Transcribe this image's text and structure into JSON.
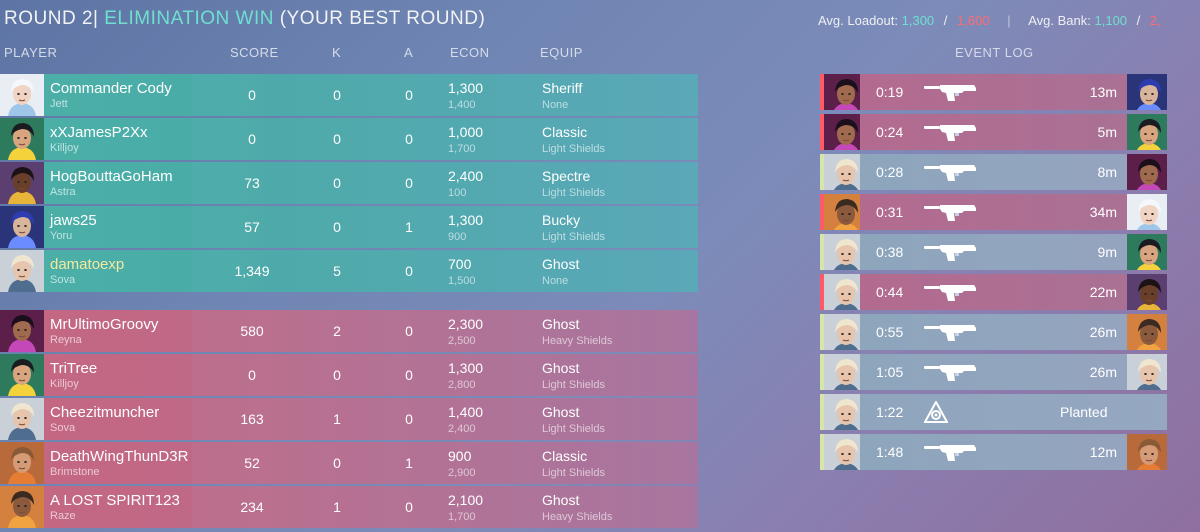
{
  "header": {
    "round": "ROUND 2|",
    "result": "ELIMINATION WIN",
    "best": "(YOUR BEST ROUND)",
    "avg_loadout_label": "Avg. Loadout:",
    "avg_loadout_ally": "1,300",
    "avg_loadout_sep": "/",
    "avg_loadout_enemy": "1,600",
    "avg_bank_label": "Avg. Bank:",
    "avg_bank_ally": "1,100",
    "avg_bank_sep": "/",
    "avg_bank_enemy": "2,"
  },
  "columns": {
    "player": "PLAYER",
    "score": "SCORE",
    "k": "K",
    "a": "A",
    "econ": "ECON",
    "equip": "EQUIP",
    "event_log": "EVENT LOG"
  },
  "players": [
    {
      "team": "ally",
      "name": "Commander Cody",
      "agent": "Jett",
      "score": "0",
      "k": "0",
      "a": "0",
      "loadout": "1,300",
      "bank": "1,400",
      "weapon": "Sheriff",
      "armor": "None",
      "portrait": "jett-portrait-icon"
    },
    {
      "team": "ally",
      "name": "xXJamesP2Xx",
      "agent": "Killjoy",
      "score": "0",
      "k": "0",
      "a": "0",
      "loadout": "1,000",
      "bank": "1,700",
      "weapon": "Classic",
      "armor": "Light Shields",
      "portrait": "killjoy-portrait-icon"
    },
    {
      "team": "ally",
      "name": "HogBouttaGoHam",
      "agent": "Astra",
      "score": "73",
      "k": "0",
      "a": "0",
      "loadout": "2,400",
      "bank": "100",
      "weapon": "Spectre",
      "armor": "Light Shields",
      "portrait": "astra-portrait-icon"
    },
    {
      "team": "ally",
      "name": "jaws25",
      "agent": "Yoru",
      "score": "57",
      "k": "0",
      "a": "1",
      "loadout": "1,300",
      "bank": "900",
      "weapon": "Bucky",
      "armor": "Light Shields",
      "portrait": "yoru-portrait-icon"
    },
    {
      "team": "ally",
      "name": "damatoexp",
      "agent": "Sova",
      "score": "1,349",
      "k": "5",
      "a": "0",
      "loadout": "700",
      "bank": "1,500",
      "weapon": "Ghost",
      "armor": "None",
      "portrait": "sova-portrait-icon",
      "highlight": true
    },
    {
      "team": "enemy",
      "name": "MrUltimoGroovy",
      "agent": "Reyna",
      "score": "580",
      "k": "2",
      "a": "0",
      "loadout": "2,300",
      "bank": "2,500",
      "weapon": "Ghost",
      "armor": "Heavy Shields",
      "portrait": "reyna-portrait-icon"
    },
    {
      "team": "enemy",
      "name": "TriTree",
      "agent": "Killjoy",
      "score": "0",
      "k": "0",
      "a": "0",
      "loadout": "1,300",
      "bank": "2,800",
      "weapon": "Ghost",
      "armor": "Light Shields",
      "portrait": "killjoy-portrait-icon"
    },
    {
      "team": "enemy",
      "name": "Cheezitmuncher",
      "agent": "Sova",
      "score": "163",
      "k": "1",
      "a": "0",
      "loadout": "1,400",
      "bank": "2,400",
      "weapon": "Ghost",
      "armor": "Light Shields",
      "portrait": "sova-portrait-icon"
    },
    {
      "team": "enemy",
      "name": "DeathWingThunD3R",
      "agent": "Brimstone",
      "score": "52",
      "k": "0",
      "a": "1",
      "loadout": "900",
      "bank": "2,900",
      "weapon": "Classic",
      "armor": "Light Shields",
      "portrait": "brimstone-portrait-icon"
    },
    {
      "team": "enemy",
      "name": "A LOST SPIRIT123",
      "agent": "Raze",
      "score": "234",
      "k": "1",
      "a": "0",
      "loadout": "2,100",
      "bank": "1,700",
      "weapon": "Ghost",
      "armor": "Heavy Shields",
      "portrait": "raze-portrait-icon"
    }
  ],
  "events": [
    {
      "type": "killer-enemy",
      "time": "0:19",
      "distance": "13m",
      "killer": "reyna-portrait-icon",
      "victim": "yoru-portrait-icon",
      "weapon": "ghost-silhouette-icon"
    },
    {
      "type": "killer-enemy",
      "time": "0:24",
      "distance": "5m",
      "killer": "reyna-portrait-icon",
      "victim": "killjoy-portrait-icon",
      "weapon": "ghost-silhouette-icon"
    },
    {
      "type": "killer-ally",
      "time": "0:28",
      "distance": "8m",
      "killer": "sova-portrait-icon",
      "victim": "reyna-portrait-icon",
      "weapon": "ghost-silhouette-icon"
    },
    {
      "type": "killer-enemy",
      "time": "0:31",
      "distance": "34m",
      "killer": "raze-portrait-icon",
      "victim": "jett-portrait-icon",
      "weapon": "ghost-silhouette-icon"
    },
    {
      "type": "killer-ally",
      "time": "0:38",
      "distance": "9m",
      "killer": "sova-portrait-icon",
      "victim": "killjoy-portrait-icon",
      "weapon": "ghost-silhouette-icon"
    },
    {
      "type": "killer-enemy",
      "time": "0:44",
      "distance": "22m",
      "killer": "sova-portrait-icon",
      "victim": "astra-portrait-icon",
      "weapon": "ghost-silhouette-icon"
    },
    {
      "type": "killer-ally",
      "time": "0:55",
      "distance": "26m",
      "killer": "sova-portrait-icon",
      "victim": "raze-portrait-icon",
      "weapon": "ghost-silhouette-icon"
    },
    {
      "type": "killer-ally",
      "time": "1:05",
      "distance": "26m",
      "killer": "sova-portrait-icon",
      "victim": "sova-portrait-icon",
      "weapon": "ghost-silhouette-icon"
    },
    {
      "type": "plant",
      "time": "1:22",
      "label": "Planted",
      "killer": "sova-portrait-icon",
      "icon": "spike-icon"
    },
    {
      "type": "killer-ally",
      "time": "1:48",
      "distance": "12m",
      "killer": "sova-portrait-icon",
      "victim": "brimstone-portrait-icon",
      "weapon": "ghost-silhouette-icon"
    }
  ],
  "colors": {
    "ally": "#4fb5ad",
    "enemy": "#c56a85",
    "accent_green": "#6fe0cf",
    "accent_red": "#ff6b72",
    "highlight_name": "#f3e9a0"
  }
}
